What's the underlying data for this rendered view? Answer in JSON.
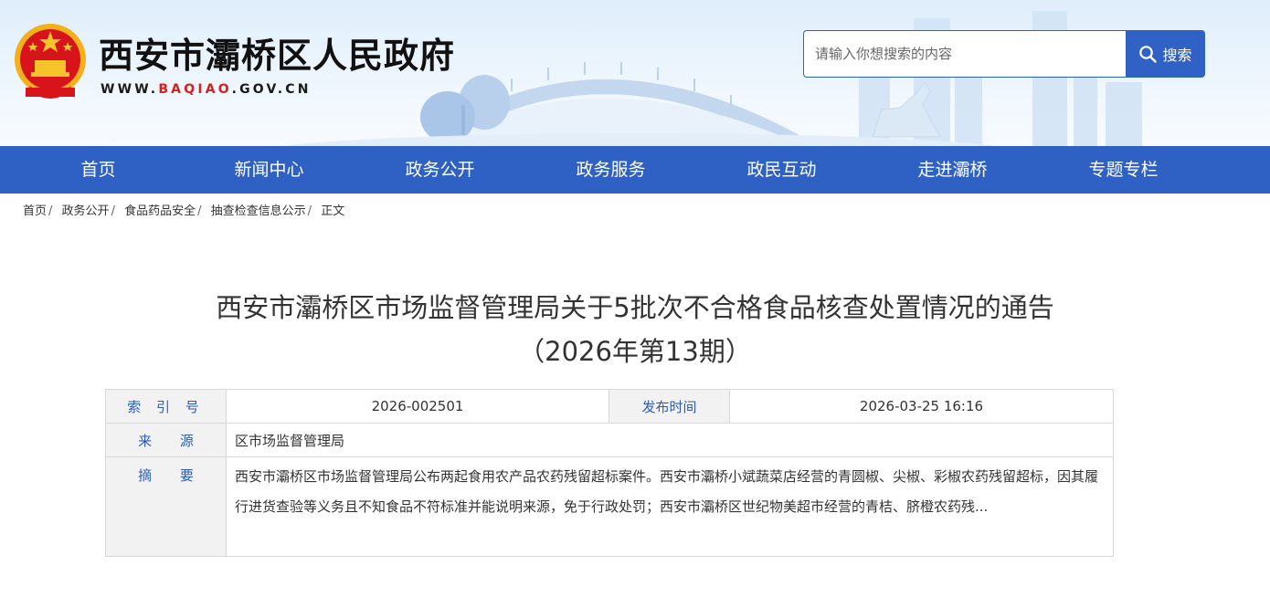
{
  "site": {
    "title": "西安市灞桥区人民政府",
    "url_prefix": "WWW.",
    "url_highlight": "BAQIAO",
    "url_suffix": ".GOV.CN"
  },
  "search": {
    "placeholder": "请输入你想搜索的内容",
    "button_label": "搜索"
  },
  "nav": {
    "items": [
      "首页",
      "新闻中心",
      "政务公开",
      "政务服务",
      "政民互动",
      "走进灞桥",
      "专题专栏"
    ]
  },
  "breadcrumb": {
    "items": [
      "首页",
      "政务公开",
      "食品药品安全",
      "抽查检查信息公示",
      "正文"
    ],
    "separator": "/"
  },
  "article": {
    "title_line1": "西安市灞桥区市场监督管理局关于5批次不合格食品核查处置情况的通告",
    "title_line2": "（2026年第13期）"
  },
  "info": {
    "index_label": "索 引 号",
    "index_value": "2026-002501",
    "publish_label": "发布时间",
    "publish_value": "2026-03-25 16:16",
    "source_label": "来 源",
    "source_value": "区市场监督管理局",
    "summary_label": "摘 要",
    "summary_value": "西安市灞桥区市场监督管理局公布两起食用农产品农药残留超标案件。西安市灞桥小斌蔬菜店经营的青圆椒、尖椒、彩椒农药残留超标，因其履行进货查验等义务且不知食品不符标准并能说明来源，免于行政处罚；西安市灞桥区世纪物美超市经营的青桔、脐橙农药残..."
  },
  "colors": {
    "nav_bg": "#2e61c3",
    "search_btn": "#2f62c4",
    "label_blue": "#2c5cb8",
    "url_red": "#d81e1e"
  }
}
